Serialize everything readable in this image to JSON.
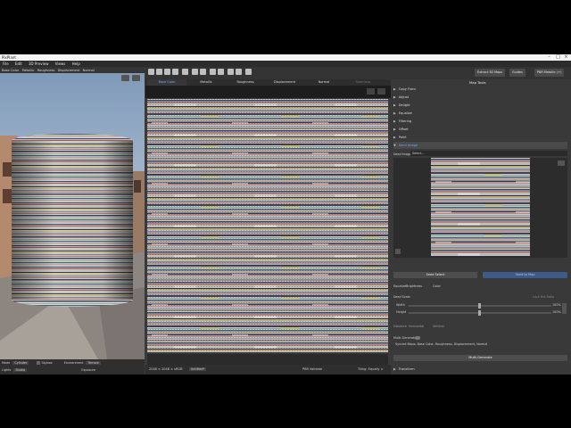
{
  "app": {
    "title": "PixPlant"
  },
  "menu": [
    "File",
    "Edit",
    "3D Preview",
    "Views",
    "Help"
  ],
  "left_toolbar": [
    "Base Color",
    "Metallic",
    "Roughness",
    "Displacement",
    "Normal"
  ],
  "left_bottom": {
    "mode_label": "Mode",
    "mode_value": "Cylinder",
    "skybox_label": "Skybox",
    "lights_label": "Lights",
    "lights_value": "Studio",
    "environment_label": "Environment",
    "environment_value": "Terrace",
    "exposure_label": "Exposure"
  },
  "tabs": [
    "Base Color",
    "Metallic",
    "Roughness",
    "Displacement",
    "Normal",
    "Seamless"
  ],
  "mid_status": {
    "resolution": "2048 × 2048 × sRGB",
    "name": "Untitled*",
    "pbr_validate": "PBR Validate",
    "tiling": "Tiling: Equally ×"
  },
  "right_top": {
    "extract_btn": "Extract 3D Maps",
    "guides_btn": "Guides",
    "pbr_btn": "PBR Metallic (+)"
  },
  "right": {
    "header": "Map Tools",
    "sections": [
      "Copy From",
      "Adjust",
      "Delight",
      "Equalize",
      "Filtering",
      "Offset",
      "Paint",
      "Seed Image"
    ],
    "seed_image_label": "Seed Image",
    "seed_image_value": "Select...",
    "seed_select_btn": "Seed Select",
    "seed_to_map_btn": "Seed to Map",
    "equalize_label": "Equalize",
    "brightness_label": "Brightness",
    "color_label": "Color",
    "seed_scale_label": "Seed Scale",
    "lock_ratio_label": "Lock the Ratio",
    "width_label": "Width",
    "width_value": "100%",
    "height_label": "Height",
    "height_value": "100%",
    "distance_label": "Distance",
    "horizontal_label": "Horizontal",
    "vertical_label": "Vertical",
    "multi_generate_label": "Multi-Generate",
    "multi_generate_desc": "Synced Maps: Base Color, Roughness, Displacement, Normal",
    "multi_generate_btn": "Multi-Generate",
    "transform_label": "Transform"
  },
  "colors": {
    "accent": "#6aa8ff",
    "panel": "#393939",
    "dark": "#1d1d1d"
  }
}
